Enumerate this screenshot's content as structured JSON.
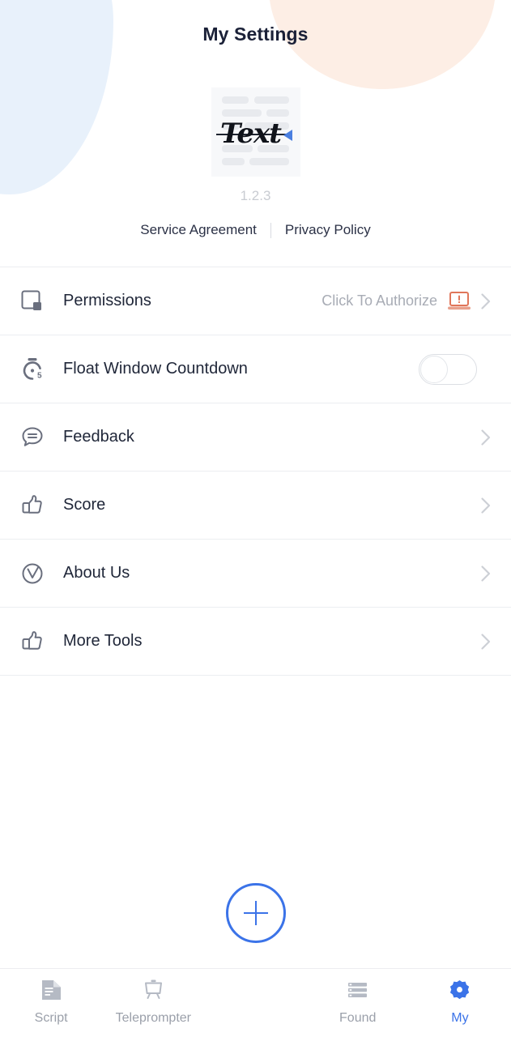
{
  "header": {
    "title": "My Settings"
  },
  "branding": {
    "logo_icon": "script-document-icon",
    "logo_text": "Text",
    "version": "1.2.3"
  },
  "legal": {
    "service_agreement": "Service Agreement",
    "privacy_policy": "Privacy Policy"
  },
  "settings": {
    "rows": [
      {
        "label": "Permissions",
        "icon": "square-corner-icon",
        "value": "Click To Authorize",
        "warn_icon": "laptop-alert-icon",
        "control": "chevron",
        "chevron_icon": "chevron-right-icon"
      },
      {
        "label": "Float Window Countdown",
        "icon": "stopwatch-5-icon",
        "value": "",
        "control": "toggle",
        "toggle_on": false
      },
      {
        "label": "Feedback",
        "icon": "chat-bubble-icon",
        "value": "",
        "control": "chevron",
        "chevron_icon": "chevron-right-icon"
      },
      {
        "label": "Score",
        "icon": "thumbs-up-icon",
        "value": "",
        "control": "chevron",
        "chevron_icon": "chevron-right-icon"
      },
      {
        "label": "About Us",
        "icon": "circle-v-icon",
        "value": "",
        "control": "chevron",
        "chevron_icon": "chevron-right-icon"
      },
      {
        "label": "More Tools",
        "icon": "thumbs-up-icon",
        "value": "",
        "control": "chevron",
        "chevron_icon": "chevron-right-icon"
      }
    ]
  },
  "tabbar": {
    "tabs": [
      {
        "label": "Script",
        "icon": "document-bookmark-icon",
        "active": false
      },
      {
        "label": "Teleprompter",
        "icon": "teleprompter-icon",
        "active": false
      },
      {
        "label": "Found",
        "icon": "list-lines-icon",
        "active": false
      },
      {
        "label": "My",
        "icon": "gear-icon",
        "active": true
      }
    ],
    "fab": {
      "icon": "plus-icon",
      "label": "+"
    }
  },
  "colors": {
    "accent": "#3b73e8",
    "title": "#1b2138",
    "muted": "#a8acb5",
    "version": "#c9ccd2",
    "warn": "#e0765a",
    "blob_blue": "#e8f1fb",
    "blob_peach": "#fdeee5"
  }
}
